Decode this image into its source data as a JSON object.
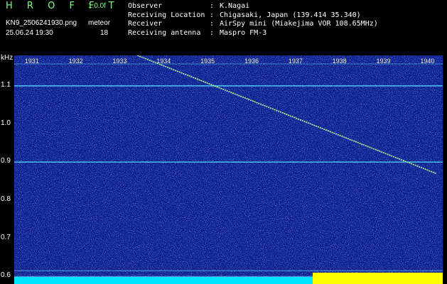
{
  "app": {
    "title": "H R O F F T",
    "version": "1.0.0f",
    "filename": "KN9_2506241930.png",
    "mode": "meteor",
    "timestamp": "25.06.24 19:30",
    "level": "18"
  },
  "info": {
    "rows": [
      {
        "label": "Observer",
        "sep": ":",
        "value": "K.Nagai"
      },
      {
        "label": "Receiving Location",
        "sep": ":",
        "value": "Chigasaki, Japan (139.414 35.340)"
      },
      {
        "label": "Receiver",
        "sep": ":",
        "value": "AirSpy mini (Miakejima VOR 108.65MHz)"
      },
      {
        "label": "Receiving antenna",
        "sep": ":",
        "value": "Maspro FM-3"
      }
    ]
  },
  "chart_data": {
    "type": "heatmap",
    "ylabel": "kHz",
    "y_ticks": [
      "1.1",
      "1.0",
      "0.9",
      "0.8",
      "0.7",
      "0.6"
    ],
    "y_ticks_values": [
      1.1,
      1.0,
      0.9,
      0.8,
      0.7,
      0.6
    ],
    "ylim": [
      0.58,
      1.18
    ],
    "x_ticks": [
      "1931",
      "1932",
      "1933",
      "1934",
      "1935",
      "1936",
      "1937",
      "1938",
      "1939",
      "1940"
    ],
    "horizontal_lines_khz": [
      1.1,
      0.9
    ],
    "trace": {
      "start_min": 1933.4,
      "start_khz": 1.18,
      "end_min": 1940.2,
      "end_khz": 0.87
    },
    "colors": {
      "background": "#071a8a",
      "line": "#4fd8ff",
      "trace": "#b8ff9a",
      "noise_floor_left": "#00e5ff",
      "noise_floor_right": "#ffff00"
    }
  }
}
